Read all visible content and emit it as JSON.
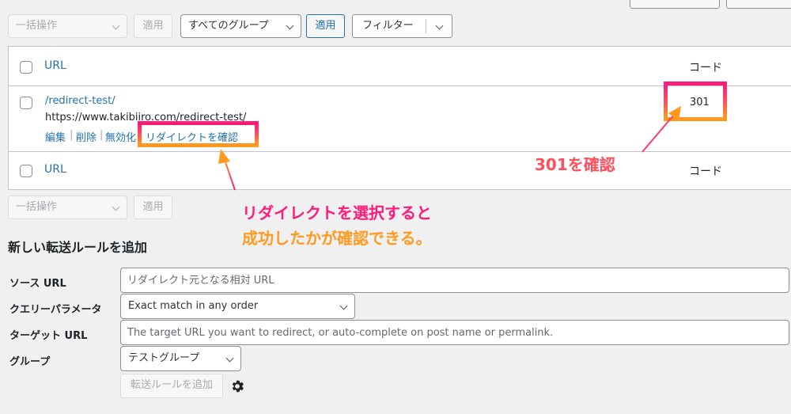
{
  "top_filters": {
    "bulk_action": "一括操作",
    "apply": "適用",
    "group_select": "すべてのグループ",
    "filter": "フィルター"
  },
  "table": {
    "header_url": "URL",
    "header_code": "コード",
    "row": {
      "source": "/redirect-test/",
      "target": "https://www.takibiiro.com/redirect-test/",
      "actions": {
        "edit": "編集",
        "delete": "削除",
        "disable": "無効化",
        "check": "リダイレクトを確認",
        "sep": "|"
      },
      "code": "301"
    },
    "footer_url": "URL",
    "footer_code": "コード"
  },
  "bottom_filters": {
    "bulk_action": "一括操作",
    "apply": "適用"
  },
  "annotations": {
    "code_note": "301を確認",
    "check_note_line1": "リダイレクトを選択すると",
    "check_note_line2": "成功したかが確認できる。"
  },
  "add_form": {
    "title": "新しい転送ルールを追加",
    "source_label": "ソース URL",
    "source_placeholder": "リダイレクト元となる相対 URL",
    "query_label": "クエリーパラメータ",
    "query_value": "Exact match in any order",
    "target_label": "ターゲット URL",
    "target_placeholder": "The target URL you want to redirect, or auto-complete on post name or permalink.",
    "group_label": "グループ",
    "group_value": "テストグループ",
    "submit": "転送ルールを追加",
    "settings_icon": "gear-icon"
  },
  "colors": {
    "link": "#2271b1",
    "annotation_pink": "#ff1a7a",
    "annotation_orange": "#ff9a1f"
  }
}
